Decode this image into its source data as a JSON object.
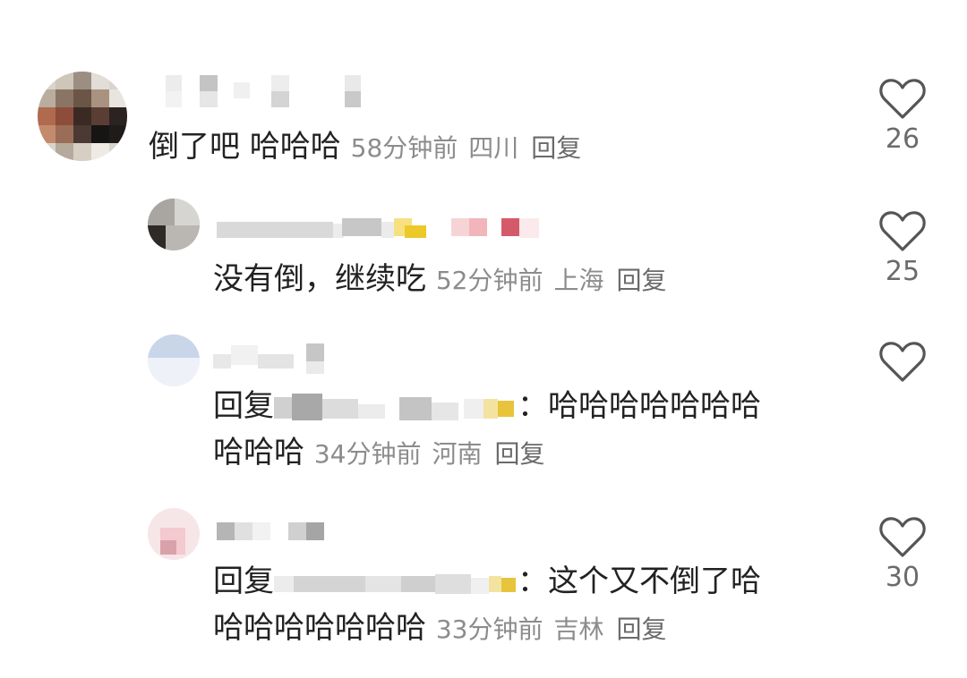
{
  "comments": [
    {
      "text": "倒了吧 哈哈哈",
      "time": "58分钟前",
      "location": "四川",
      "reply_label": "回复",
      "likes": "26"
    },
    {
      "text": "没有倒，继续吃",
      "time": "52分钟前",
      "location": "上海",
      "reply_label": "回复",
      "likes": "25"
    },
    {
      "reply_prefix": "回复",
      "colon": "：",
      "text_line1": "哈哈哈哈哈哈哈",
      "text_line2": "哈哈哈",
      "time": "34分钟前",
      "location": "河南",
      "reply_label": "回复",
      "likes": ""
    },
    {
      "reply_prefix": "回复",
      "colon": "：",
      "text_line1": "这个又不倒了哈",
      "text_line2": "哈哈哈哈哈哈哈",
      "time": "33分钟前",
      "location": "吉林",
      "reply_label": "回复",
      "likes": "30"
    }
  ],
  "icons": {
    "like": "heart-outline-icon"
  },
  "colors": {
    "text": "#222222",
    "meta": "#8c8c8c",
    "heart": "#555555"
  }
}
